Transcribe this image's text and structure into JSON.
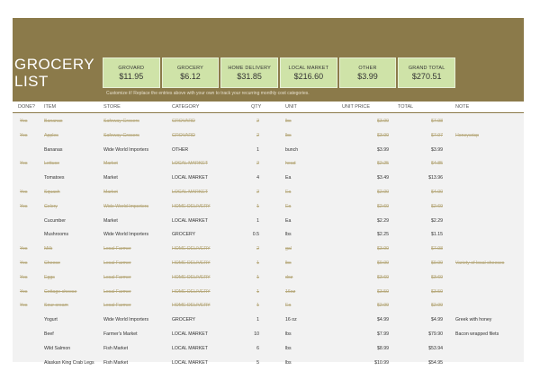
{
  "title": "GROCERY LIST",
  "summary": [
    {
      "label": "GROVARD",
      "value": "$11.95"
    },
    {
      "label": "GROCERY",
      "value": "$6.12"
    },
    {
      "label": "HOME DELIVERY",
      "value": "$31.85"
    },
    {
      "label": "LOCAL MARKET",
      "value": "$216.60"
    },
    {
      "label": "OTHER",
      "value": "$3.99"
    },
    {
      "label": "GRAND TOTAL",
      "value": "$270.51"
    }
  ],
  "hint": "Customize it! Replace the entries above with your own to track your recurring monthly cost categories.",
  "columns": [
    "DONE?",
    "ITEM",
    "STORE",
    "CATEGORY",
    "QTY",
    "UNIT",
    "UNIT PRICE",
    "TOTAL",
    "NOTE"
  ],
  "rows": [
    {
      "done": "Yes",
      "item": "Bananas",
      "store": "Safeway Grocers",
      "category": "GROVARD",
      "qty": "2",
      "unit": "lbs",
      "price": "$3.99",
      "total": "$7.98",
      "note": "",
      "isdone": true
    },
    {
      "done": "Yes",
      "item": "Apples",
      "store": "Safeway Grocers",
      "category": "GROVARD",
      "qty": "2",
      "unit": "lbs",
      "price": "$3.99",
      "total": "$7.97",
      "note": "Honeycrisp",
      "isdone": true
    },
    {
      "done": "",
      "item": "Bananas",
      "store": "Wide World Importers",
      "category": "OTHER",
      "qty": "1",
      "unit": "bunch",
      "price": "$3.99",
      "total": "$3.99",
      "note": "",
      "isdone": false
    },
    {
      "done": "Yes",
      "item": "Lettuce",
      "store": "Market",
      "category": "LOCAL MARKET",
      "qty": "2",
      "unit": "head",
      "price": "$2.25",
      "total": "$4.85",
      "note": "",
      "isdone": true
    },
    {
      "done": "",
      "item": "Tomatoes",
      "store": "Market",
      "category": "LOCAL MARKET",
      "qty": "4",
      "unit": "Ea",
      "price": "$3.49",
      "total": "$13.96",
      "note": "",
      "isdone": false
    },
    {
      "done": "Yes",
      "item": "Squash",
      "store": "Market",
      "category": "LOCAL MARKET",
      "qty": "2",
      "unit": "Ea",
      "price": "$2.00",
      "total": "$4.00",
      "note": "",
      "isdone": true
    },
    {
      "done": "Yes",
      "item": "Celery",
      "store": "Wide World Importers",
      "category": "HOME DELIVERY",
      "qty": "1",
      "unit": "Ea",
      "price": "$2.69",
      "total": "$2.69",
      "note": "",
      "isdone": true
    },
    {
      "done": "",
      "item": "Cucumber",
      "store": "Market",
      "category": "LOCAL MARKET",
      "qty": "1",
      "unit": "Ea",
      "price": "$2.29",
      "total": "$2.29",
      "note": "",
      "isdone": false
    },
    {
      "done": "",
      "item": "Mushrooms",
      "store": "Wide World Importers",
      "category": "GROCERY",
      "qty": "0.5",
      "unit": "lbs",
      "price": "$2.25",
      "total": "$1.15",
      "note": "",
      "isdone": false
    },
    {
      "done": "Yes",
      "item": "Milk",
      "store": "Local Farmer",
      "category": "HOME DELIVERY",
      "qty": "2",
      "unit": "gal",
      "price": "$3.99",
      "total": "$7.98",
      "note": "",
      "isdone": true
    },
    {
      "done": "Yes",
      "item": "Cheese",
      "store": "Local Farmer",
      "category": "HOME DELIVERY",
      "qty": "1",
      "unit": "lbs",
      "price": "$9.99",
      "total": "$9.99",
      "note": "Variety of local cheeses",
      "isdone": true
    },
    {
      "done": "Yes",
      "item": "Eggs",
      "store": "Local Farmer",
      "category": "HOME DELIVERY",
      "qty": "1",
      "unit": "doz",
      "price": "$3.69",
      "total": "$3.69",
      "note": "",
      "isdone": true
    },
    {
      "done": "Yes",
      "item": "Cottage cheese",
      "store": "Local Farmer",
      "category": "HOME DELIVERY",
      "qty": "1",
      "unit": "16oz",
      "price": "$3.59",
      "total": "$3.59",
      "note": "",
      "isdone": true
    },
    {
      "done": "Yes",
      "item": "Sour cream",
      "store": "Local Farmer",
      "category": "HOME DELIVERY",
      "qty": "1",
      "unit": "Ea",
      "price": "$2.99",
      "total": "$2.99",
      "note": "",
      "isdone": true
    },
    {
      "done": "",
      "item": "Yogurt",
      "store": "Wide World Importers",
      "category": "GROCERY",
      "qty": "1",
      "unit": "16 oz",
      "price": "$4.99",
      "total": "$4.99",
      "note": "Greek with honey",
      "isdone": false
    },
    {
      "done": "",
      "item": "Beef",
      "store": "Farmer's Market",
      "category": "LOCAL MARKET",
      "qty": "10",
      "unit": "lbs",
      "price": "$7.99",
      "total": "$79.90",
      "note": "Bacon wrapped filets",
      "isdone": false
    },
    {
      "done": "",
      "item": "Wild Salmon",
      "store": "Fish Market",
      "category": "LOCAL MARKET",
      "qty": "6",
      "unit": "lbs",
      "price": "$8.99",
      "total": "$53.94",
      "note": "",
      "isdone": false
    },
    {
      "done": "",
      "item": "Alaskan King Crab Legs",
      "store": "Fish Market",
      "category": "LOCAL MARKET",
      "qty": "5",
      "unit": "lbs",
      "price": "$10.99",
      "total": "$54.95",
      "note": "",
      "isdone": false
    }
  ]
}
